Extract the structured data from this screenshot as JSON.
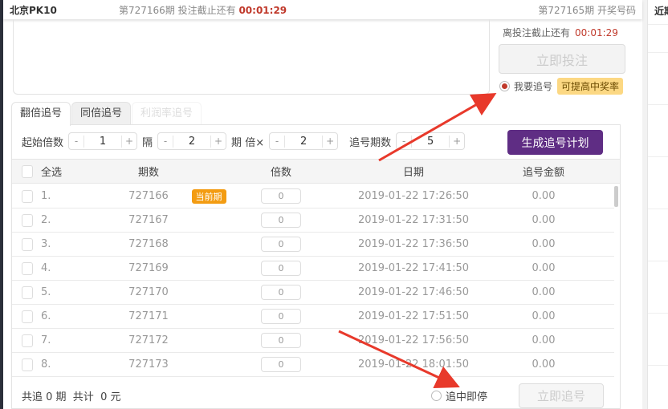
{
  "header": {
    "lottery": "北京PK10",
    "current_issue": "第727166期 投注截止还有",
    "countdown": "00:01:29",
    "last_issue": "第727165期 开奖号码"
  },
  "right_panel": {
    "title": "近期"
  },
  "bet": {
    "deadline_label": "离投注截止还有",
    "deadline": "00:01:29",
    "bet_button": "立即投注",
    "chase_label": "我要追号",
    "chase_tag": "可提高中奖率"
  },
  "tabs": [
    {
      "label": "翻倍追号"
    },
    {
      "label": "同倍追号"
    },
    {
      "label": "利润率追号"
    }
  ],
  "controls": {
    "start_mult_label": "起始倍数",
    "start_mult": "1",
    "interval_label": "隔",
    "interval": "2",
    "period_label": "期",
    "times_label": "倍×",
    "times": "2",
    "chase_count_label": "追号期数",
    "chase_count": "5",
    "generate_button": "生成追号计划",
    "minus": "-",
    "plus": "+"
  },
  "table": {
    "headers": [
      "全选",
      "期数",
      "倍数",
      "日期",
      "追号金额"
    ],
    "current_tag": "当前期",
    "rows": [
      {
        "idx": "1.",
        "issue": "727166",
        "mult": "0",
        "date": "2019-01-22 17:26:50",
        "amount": "0.00"
      },
      {
        "idx": "2.",
        "issue": "727167",
        "mult": "0",
        "date": "2019-01-22 17:31:50",
        "amount": "0.00"
      },
      {
        "idx": "3.",
        "issue": "727168",
        "mult": "0",
        "date": "2019-01-22 17:36:50",
        "amount": "0.00"
      },
      {
        "idx": "4.",
        "issue": "727169",
        "mult": "0",
        "date": "2019-01-22 17:41:50",
        "amount": "0.00"
      },
      {
        "idx": "5.",
        "issue": "727170",
        "mult": "0",
        "date": "2019-01-22 17:46:50",
        "amount": "0.00"
      },
      {
        "idx": "6.",
        "issue": "727171",
        "mult": "0",
        "date": "2019-01-22 17:51:50",
        "amount": "0.00"
      },
      {
        "idx": "7.",
        "issue": "727172",
        "mult": "0",
        "date": "2019-01-22 17:56:50",
        "amount": "0.00"
      },
      {
        "idx": "8.",
        "issue": "727173",
        "mult": "0",
        "date": "2019-01-22 18:01:50",
        "amount": "0.00"
      }
    ]
  },
  "footer": {
    "summary": "共追 0 期  共计  0 元",
    "stop_label": "追中即停",
    "chase_button": "立即追号"
  }
}
